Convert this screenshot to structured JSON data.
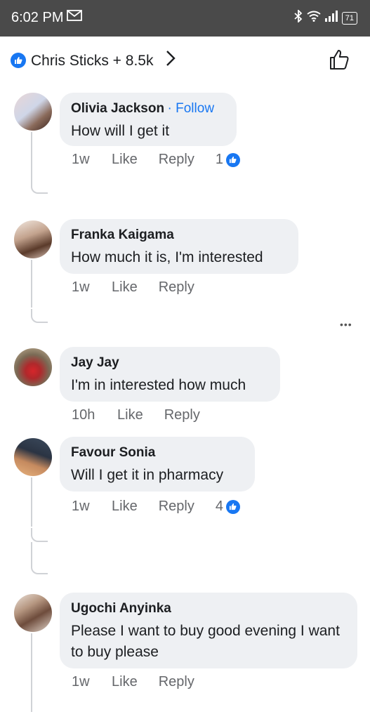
{
  "status_bar": {
    "time": "6:02 PM",
    "battery": "71"
  },
  "header": {
    "reactors": "Chris Sticks + 8.5k",
    "colors": {
      "brand": "#1877f2"
    }
  },
  "comments": [
    {
      "author": "Olivia Jackson",
      "follow": "· Follow",
      "text": "How will I get it",
      "time": "1w",
      "like": "Like",
      "reply": "Reply",
      "reactions": "1"
    },
    {
      "author": "Franka Kaigama",
      "text": "How much it is, I'm interested",
      "time": "1w",
      "like": "Like",
      "reply": "Reply"
    },
    {
      "author": "Jay Jay",
      "text": "I'm in interested how much",
      "time": "10h",
      "like": "Like",
      "reply": "Reply"
    },
    {
      "author": "Favour Sonia",
      "text": "Will I get it in pharmacy",
      "time": "1w",
      "like": "Like",
      "reply": "Reply",
      "reactions": "4"
    },
    {
      "author": "Ugochi Anyinka",
      "text": "Please I want to buy good evening I want to buy please",
      "time": "1w",
      "like": "Like",
      "reply": "Reply"
    }
  ]
}
